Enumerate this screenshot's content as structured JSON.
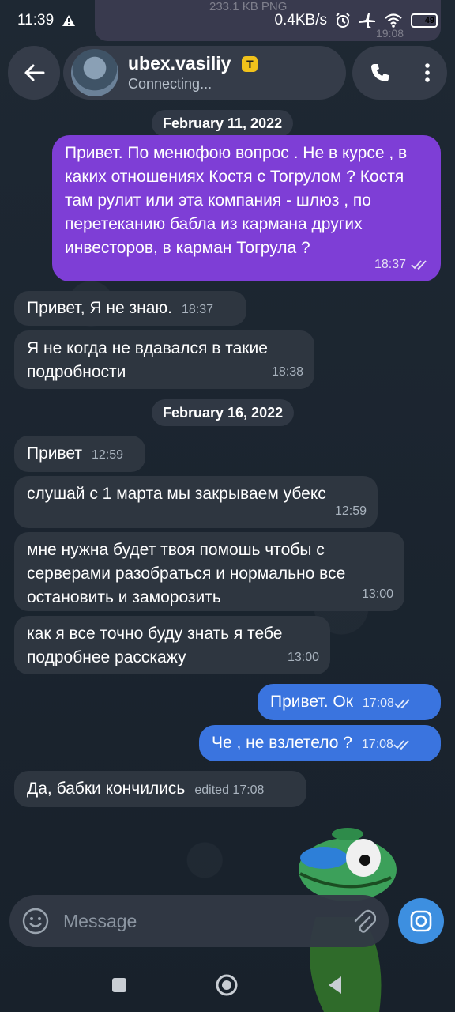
{
  "status_bar": {
    "time": "11:39",
    "speed": "0.4KB/s",
    "battery": "49",
    "battery_level": 0.49,
    "icons": [
      "alert-icon",
      "alarm-icon",
      "airplane-icon",
      "wifi-icon",
      "battery-icon"
    ]
  },
  "ghost_message": {
    "size": "233.1 KB PNG",
    "time": "19:08"
  },
  "header": {
    "title": "ubex.vasiliy",
    "badge": "T",
    "subtitle": "Connecting..."
  },
  "dates": [
    "February 11, 2022",
    "February 16, 2022"
  ],
  "messages": [
    {
      "direction": "out",
      "text": "Привет. По менюфою вопрос .  Не в курсе , в каких отношениях Костя с Тогрулом ? Костя там рулит или эта компания - шлюз , по перетеканию бабла из кармана других инвесторов, в карман Тогрула ?",
      "time": "18:37",
      "read": true
    },
    {
      "direction": "in",
      "text": "Привет, Я не знаю.",
      "time": "18:37"
    },
    {
      "direction": "in",
      "text": "Я не когда не вдавался в такие подробности",
      "time": "18:38"
    },
    {
      "direction": "in",
      "text": "Привет",
      "time": "12:59"
    },
    {
      "direction": "in",
      "text": "слушай с 1 марта мы закрываем убекс",
      "time": "12:59"
    },
    {
      "direction": "in",
      "text": "мне нужна будет твоя помошь чтобы с серверами разобраться и нормально все остановить и заморозить",
      "time": "13:00"
    },
    {
      "direction": "in",
      "text": "как я все точно буду знать я тебе подробнее расскажу",
      "time": "13:00"
    },
    {
      "direction": "out",
      "text": "Привет. Ок",
      "time": "17:08",
      "read": true
    },
    {
      "direction": "out",
      "text": "Че , не взлетело ?",
      "time": "17:08",
      "read": true
    },
    {
      "direction": "in",
      "text": "Да, бабки кончились",
      "time": "edited 17:08"
    }
  ],
  "composer": {
    "placeholder": "Message"
  },
  "colors": {
    "outgoing_purple": "#7e3ed6",
    "outgoing_blue": "#3a74df",
    "incoming": "#2e3640",
    "accent": "#3d8fe0"
  }
}
